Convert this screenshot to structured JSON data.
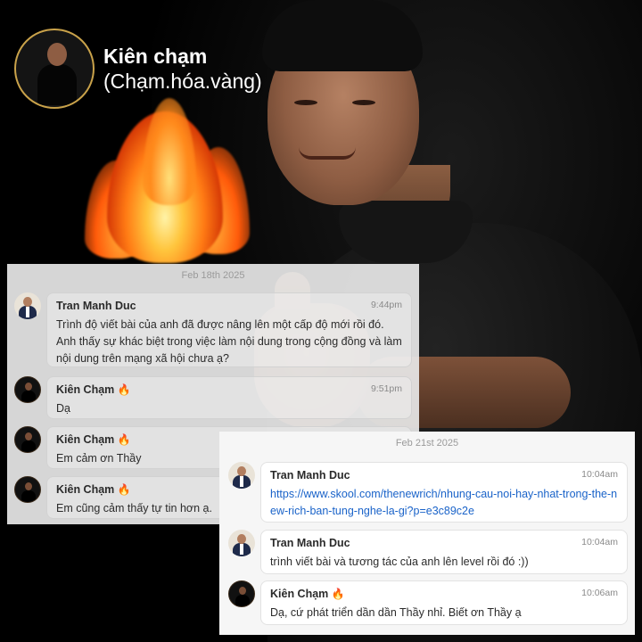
{
  "profile": {
    "name": "Kiên chạm",
    "handle": "(Chạm.hóa.vàng)"
  },
  "colors": {
    "background": "#000000",
    "gold_ring": "#c9a24a",
    "link": "#1a63c9",
    "flame": "#ff7a14"
  },
  "chat_left": {
    "date": "Feb 18th 2025",
    "messages": [
      {
        "sender": "Tran Manh Duc",
        "time": "9:44pm",
        "text": "Trình độ viết bài của anh đã được nâng lên một cấp độ mới rồi đó. Anh thấy sự khác biệt trong việc làm nội dung trong cộng đồng và làm nội dung trên mạng xã hội chưa ạ?"
      },
      {
        "sender": "Kiên Chạm",
        "sender_emoji": "🔥",
        "time": "9:51pm",
        "text": "Dạ"
      },
      {
        "sender": "Kiên Chạm",
        "sender_emoji": "🔥",
        "time": "",
        "text": "Em cảm ơn Thầy"
      },
      {
        "sender": "Kiên Chạm",
        "sender_emoji": "🔥",
        "time": "",
        "text": "Em cũng cảm thấy tự tin hơn ạ."
      }
    ]
  },
  "chat_right": {
    "date": "Feb 21st 2025",
    "messages": [
      {
        "sender": "Tran Manh Duc",
        "time": "10:04am",
        "link": "https://www.skool.com/thenewrich/nhung-cau-noi-hay-nhat-trong-the-new-rich-ban-tung-nghe-la-gi?p=e3c89c2e"
      },
      {
        "sender": "Tran Manh Duc",
        "time": "10:04am",
        "text": "trình viết bài và tương tác của anh lên level rồi đó :))"
      },
      {
        "sender": "Kiên Chạm",
        "sender_emoji": "🔥",
        "time": "10:06am",
        "text": "Dạ, cứ phát triển dần dần Thầy nhỉ. Biết ơn Thầy ạ"
      }
    ]
  },
  "icons": {
    "fire": "fire-emoji-icon",
    "avatar_duc": "avatar",
    "avatar_kien": "avatar"
  }
}
